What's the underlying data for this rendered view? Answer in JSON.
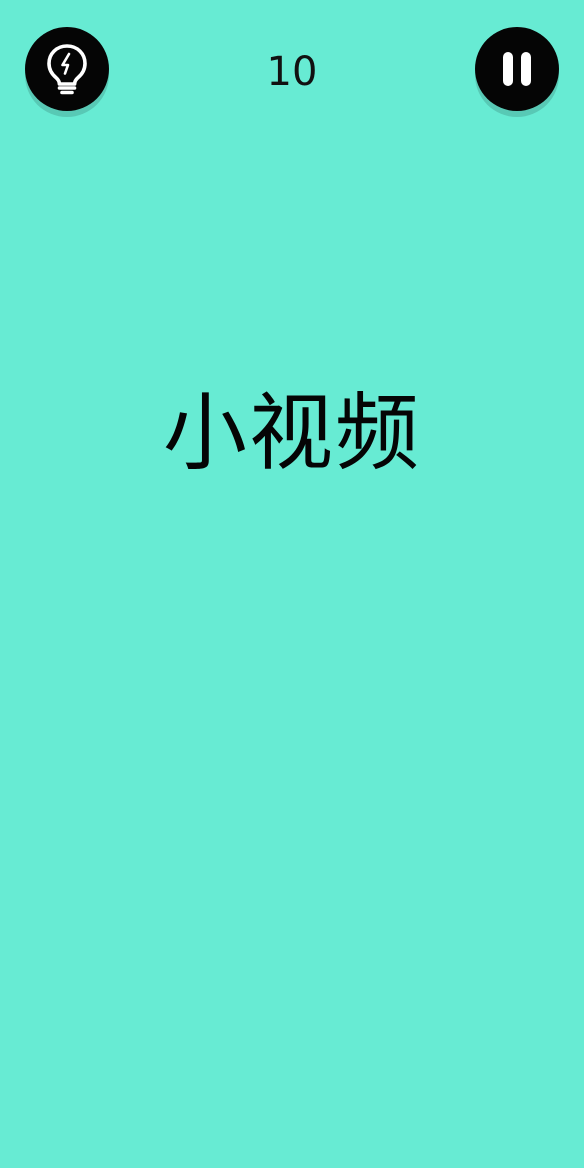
{
  "theme": {
    "background": "#67EBD3",
    "button_color": "#050505",
    "icon_color": "#FFFFFF",
    "text_color": "#050505"
  },
  "hud": {
    "hint_icon": "lightbulb-icon",
    "pause_icon": "pause-icon",
    "score": "10"
  },
  "word_card": {
    "word": "小视频"
  }
}
